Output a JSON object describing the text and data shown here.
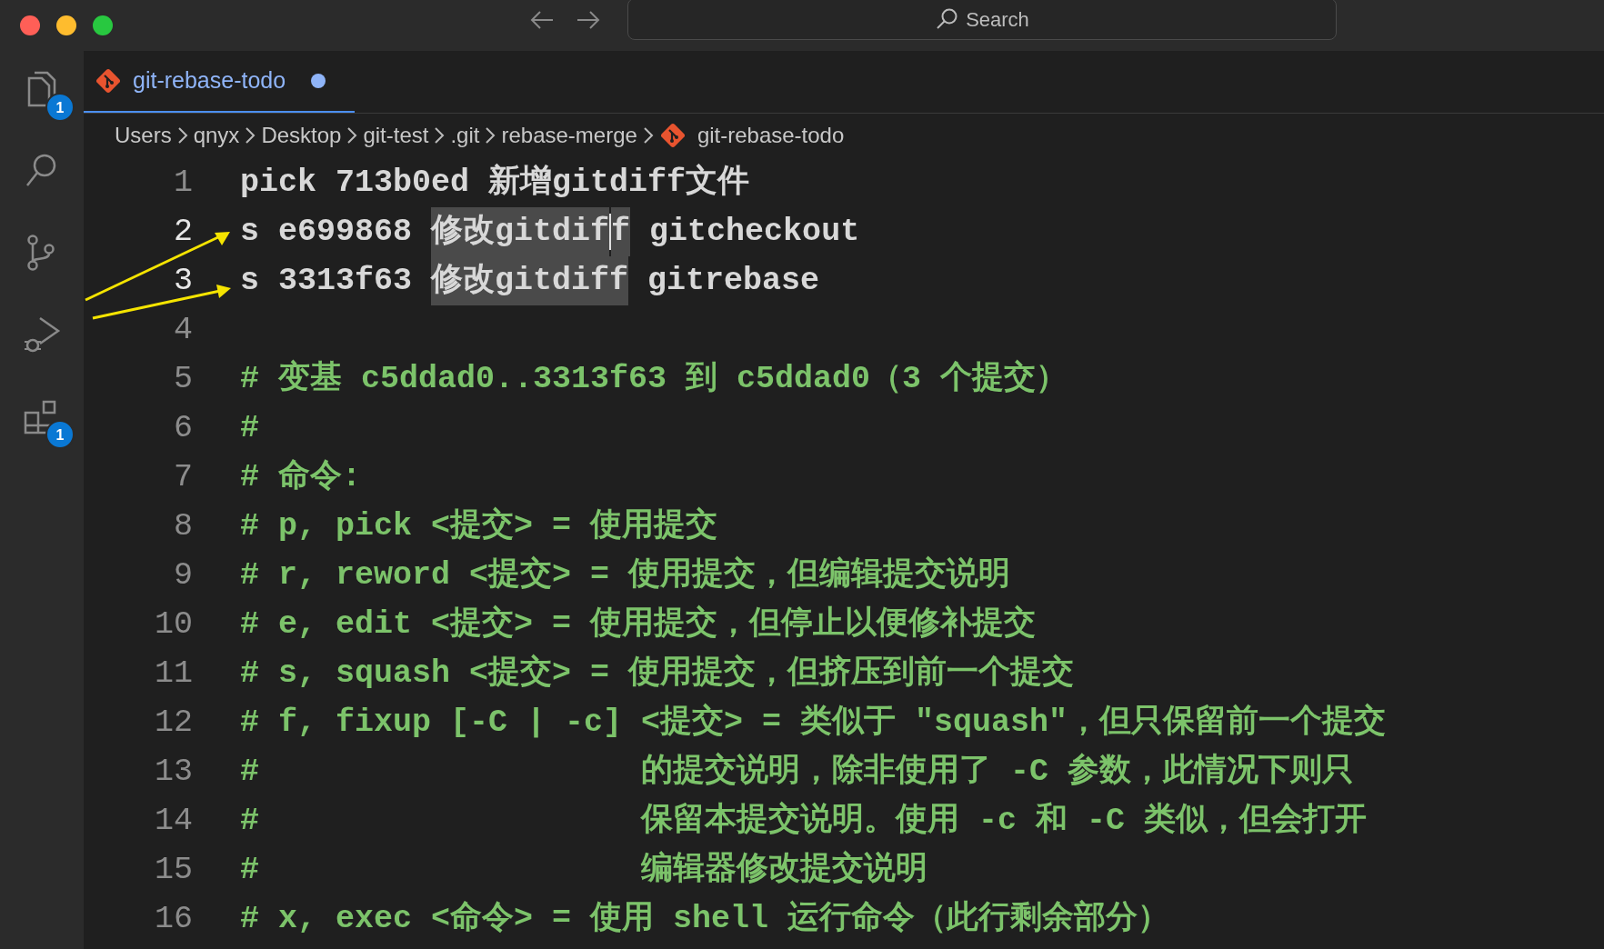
{
  "title_bar": {
    "search": {
      "placeholder": "Search"
    }
  },
  "activity_bar": [
    {
      "kind": "files",
      "badge": "1"
    },
    {
      "kind": "search"
    },
    {
      "kind": "scm"
    },
    {
      "kind": "debug"
    },
    {
      "kind": "extensions",
      "badge": "1"
    }
  ],
  "tabs": [
    {
      "label": "git-rebase-todo",
      "selected": true,
      "modified": true
    }
  ],
  "breadcrumbs": [
    {
      "label": "Users"
    },
    {
      "label": "qnyx"
    },
    {
      "label": "Desktop"
    },
    {
      "label": "git-test"
    },
    {
      "label": ".git"
    },
    {
      "label": "rebase-merge"
    },
    {
      "label": "git-rebase-todo",
      "file": true
    }
  ],
  "lines": [
    {
      "number": "1",
      "active": false,
      "kind": "command",
      "parts": [
        {
          "text": "pick 713b0ed 新增gitdiff文件",
          "selected": false
        }
      ]
    },
    {
      "number": "2",
      "active": true,
      "kind": "command",
      "parts": [
        {
          "text": "s e699868 ",
          "selected": false
        },
        {
          "text": "修改gitdif",
          "selected": true,
          "cursor": true
        },
        {
          "text": "f",
          "selected": true
        },
        {
          "text": " gitcheckout",
          "selected": false
        }
      ]
    },
    {
      "number": "3",
      "active": true,
      "kind": "command",
      "parts": [
        {
          "text": "s 3313f63 ",
          "selected": false
        },
        {
          "text": "修改gitdiff",
          "selected": true
        },
        {
          "text": " gitrebase",
          "selected": false
        }
      ]
    },
    {
      "number": "4",
      "active": false,
      "kind": "command"
    },
    {
      "number": "5",
      "active": false,
      "kind": "comment",
      "parts": [
        {
          "text": "# 变基 c5ddad0..3313f63 到 c5ddad0（3 个提交）",
          "selected": false
        }
      ]
    },
    {
      "number": "6",
      "active": false,
      "kind": "comment",
      "parts": [
        {
          "text": "#",
          "selected": false
        }
      ]
    },
    {
      "number": "7",
      "active": false,
      "kind": "comment",
      "parts": [
        {
          "text": "# 命令:",
          "selected": false
        }
      ]
    },
    {
      "number": "8",
      "active": false,
      "kind": "comment",
      "parts": [
        {
          "text": "# p, pick <提交> = 使用提交",
          "selected": false
        }
      ]
    },
    {
      "number": "9",
      "active": false,
      "kind": "comment",
      "parts": [
        {
          "text": "# r, reword <提交> = 使用提交，但编辑提交说明",
          "selected": false
        }
      ]
    },
    {
      "number": "10",
      "active": false,
      "kind": "comment",
      "parts": [
        {
          "text": "# e, edit <提交> = 使用提交，但停止以便修补提交",
          "selected": false
        }
      ]
    },
    {
      "number": "11",
      "active": false,
      "kind": "comment",
      "parts": [
        {
          "text": "# s, squash <提交> = 使用提交，但挤压到前一个提交",
          "selected": false
        }
      ]
    },
    {
      "number": "12",
      "active": false,
      "kind": "comment",
      "parts": [
        {
          "text": "# f, fixup [-C | -c] <提交> = 类似于 \"squash\"，但只保留前一个提交",
          "selected": false
        }
      ]
    },
    {
      "number": "13",
      "active": false,
      "kind": "comment",
      "parts": [
        {
          "text": "#                    的提交说明，除非使用了 -C 参数，此情况下则只",
          "selected": false
        }
      ]
    },
    {
      "number": "14",
      "active": false,
      "kind": "comment",
      "parts": [
        {
          "text": "#                    保留本提交说明。使用 -c 和 -C 类似，但会打开",
          "selected": false
        }
      ]
    },
    {
      "number": "15",
      "active": false,
      "kind": "comment",
      "parts": [
        {
          "text": "#                    编辑器修改提交说明",
          "selected": false
        }
      ]
    },
    {
      "number": "16",
      "active": false,
      "kind": "comment",
      "parts": [
        {
          "text": "# x, exec <命令> = 使用 shell 运行命令（此行剩余部分）",
          "selected": false
        }
      ]
    }
  ]
}
